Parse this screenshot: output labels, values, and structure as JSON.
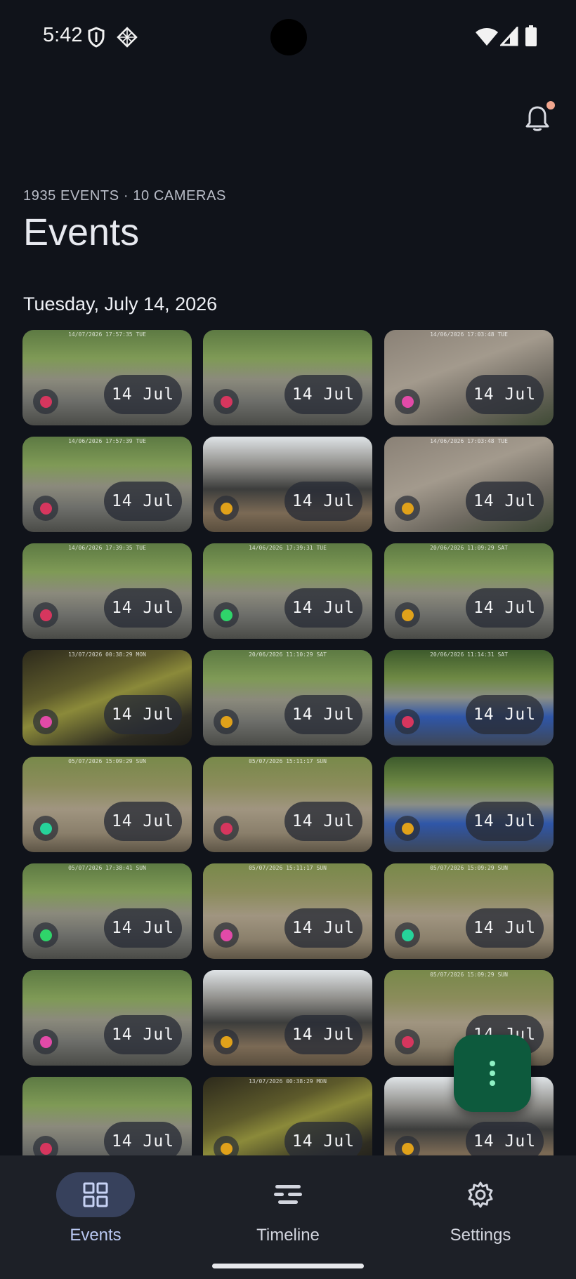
{
  "status_bar": {
    "time": "5:42",
    "icons": [
      "shield-icon",
      "diamond-grid-icon",
      "wifi-icon",
      "signal-icon",
      "battery-icon"
    ]
  },
  "header": {
    "subtitle": "1935 EVENTS · 10 CAMERAS",
    "title": "Events",
    "notification_icon": "bell-icon",
    "has_unread": true
  },
  "section": {
    "date_heading": "Tuesday, July 14, 2026"
  },
  "colors": {
    "background": "#10131a",
    "nav_background": "#1d2027",
    "active_pill": "#37415c",
    "fab": "#0d5a3d",
    "dot_magenta": "#e24aa8",
    "dot_red": "#d6365e",
    "dot_orange": "#e0a11a",
    "dot_green": "#2fd46a",
    "dot_teal": "#26d39a"
  },
  "events": [
    {
      "date": "14 Jul",
      "dot": "#d6365e",
      "scene": "driveway",
      "stamp": "14/07/2026 17:57:35 TUE"
    },
    {
      "date": "14 Jul",
      "dot": "#d6365e",
      "scene": "driveway",
      "stamp": ""
    },
    {
      "date": "14 Jul",
      "dot": "#e24aa8",
      "scene": "gravel",
      "stamp": "14/06/2026 17:03:48 TUE"
    },
    {
      "date": "14 Jul",
      "dot": "#d6365e",
      "scene": "driveway",
      "stamp": "14/06/2026 17:57:39 TUE"
    },
    {
      "date": "14 Jul",
      "dot": "#e0a11a",
      "scene": "house",
      "stamp": ""
    },
    {
      "date": "14 Jul",
      "dot": "#e0a11a",
      "scene": "gravel",
      "stamp": "14/06/2026 17:03:48 TUE"
    },
    {
      "date": "14 Jul",
      "dot": "#d6365e",
      "scene": "driveway",
      "stamp": "14/06/2026 17:39:35 TUE"
    },
    {
      "date": "14 Jul",
      "dot": "#2fd46a",
      "scene": "driveway",
      "stamp": "14/06/2026 17:39:31 TUE"
    },
    {
      "date": "14 Jul",
      "dot": "#e0a11a",
      "scene": "driveway",
      "stamp": "20/06/2026 11:09:29 SAT"
    },
    {
      "date": "14 Jul",
      "dot": "#e24aa8",
      "scene": "dark",
      "stamp": "13/07/2026 00:38:29 MON"
    },
    {
      "date": "14 Jul",
      "dot": "#e0a11a",
      "scene": "driveway",
      "stamp": "20/06/2026 11:10:29 SAT"
    },
    {
      "date": "14 Jul",
      "dot": "#d6365e",
      "scene": "bluecar",
      "stamp": "20/06/2026 11:14:31 SAT"
    },
    {
      "date": "14 Jul",
      "dot": "#26d39a",
      "scene": "yard",
      "stamp": "05/07/2026 15:09:29 SUN"
    },
    {
      "date": "14 Jul",
      "dot": "#d6365e",
      "scene": "yard",
      "stamp": "05/07/2026 15:11:17 SUN"
    },
    {
      "date": "14 Jul",
      "dot": "#e0a11a",
      "scene": "bluecar",
      "stamp": ""
    },
    {
      "date": "14 Jul",
      "dot": "#2fd46a",
      "scene": "driveway",
      "stamp": "05/07/2026 17:38:41 SUN"
    },
    {
      "date": "14 Jul",
      "dot": "#e24aa8",
      "scene": "yard",
      "stamp": "05/07/2026 15:11:17 SUN"
    },
    {
      "date": "14 Jul",
      "dot": "#26d39a",
      "scene": "yard",
      "stamp": "05/07/2026 15:09:29 SUN"
    },
    {
      "date": "14 Jul",
      "dot": "#e24aa8",
      "scene": "driveway",
      "stamp": ""
    },
    {
      "date": "14 Jul",
      "dot": "#e0a11a",
      "scene": "house",
      "stamp": ""
    },
    {
      "date": "14 Jul",
      "dot": "#d6365e",
      "scene": "yard",
      "stamp": "05/07/2026 15:09:29 SUN"
    },
    {
      "date": "14 Jul",
      "dot": "#d6365e",
      "scene": "driveway",
      "stamp": ""
    },
    {
      "date": "14 Jul",
      "dot": "#e0a11a",
      "scene": "dark",
      "stamp": "13/07/2026 00:38:29 MON"
    },
    {
      "date": "14 Jul",
      "dot": "#e0a11a",
      "scene": "house",
      "stamp": ""
    }
  ],
  "fab": {
    "icon": "more-vertical-icon"
  },
  "nav": {
    "items": [
      {
        "label": "Events",
        "icon": "grid-icon",
        "active": true
      },
      {
        "label": "Timeline",
        "icon": "timeline-icon",
        "active": false
      },
      {
        "label": "Settings",
        "icon": "gear-icon",
        "active": false
      }
    ]
  }
}
